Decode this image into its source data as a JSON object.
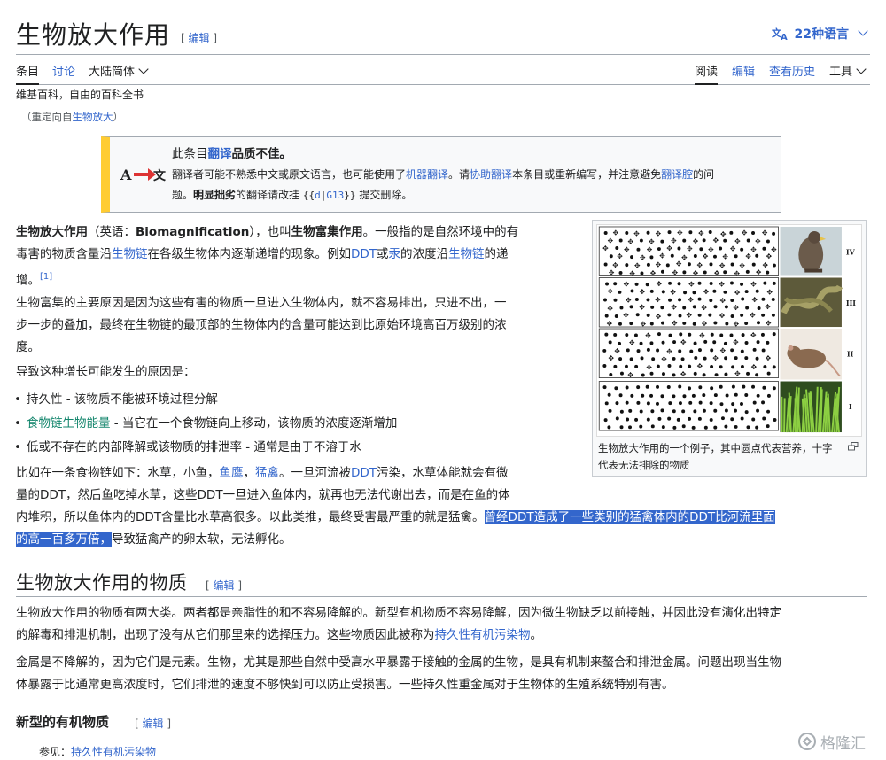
{
  "header": {
    "title": "生物放大作用",
    "edit_label": "编辑",
    "languages_label": "22种语言",
    "languages_icon": "translate-icon"
  },
  "tabs": {
    "article": "条目",
    "talk": "讨论",
    "variant": "大陆简体",
    "read": "阅读",
    "edit": "编辑",
    "history": "查看历史",
    "tools": "工具"
  },
  "tagline": "维基百科，自由的百科全书",
  "redirect": {
    "open": "（重定向自",
    "link": "生物放大",
    "close": "）"
  },
  "ambox": {
    "icon": "translation-arrow-icon",
    "icon_a": "A",
    "icon_b": "文",
    "l1_a": "此条目",
    "l1_b": "翻译",
    "l1_c": "品质不佳。",
    "l2_a": "翻译者可能不熟悉中文或原文语言，也可能使用了",
    "l2_b": "机器翻译",
    "l2_c": "。请",
    "l2_d": "协助翻译",
    "l2_e": "本条目或重新编写，并注意避免",
    "l2_f": "翻译腔",
    "l2_g": "的问",
    "l3_a": "题。",
    "l3_b": "明显拙劣",
    "l3_c": "的翻译请改挂",
    "l3_code_a": "{{",
    "l3_code_b": "d",
    "l3_code_c": "|",
    "l3_code_d": "G13",
    "l3_code_e": "}}",
    "l3_d": "提交删除。"
  },
  "intro": {
    "a": "生物放大作用",
    "b": "（英语：",
    "c": "Biomagnification",
    "d": "），也叫",
    "e": "生物富集作用",
    "f": "。一般指的是自然环境中的有",
    "g": "毒害的物质含量沿",
    "h": "生物链",
    "i": "在各级生物体内逐渐递增的现象。例如",
    "j": "DDT",
    "k": "或",
    "l": "汞",
    "m": "的浓度沿",
    "n": "生物链",
    "o": "的递",
    "p": "增。",
    "ref": "[1]"
  },
  "p2": {
    "l1": "生物富集的主要原因是因为这些有害的物质一旦进入生物体内，就不容易排出，只进不出，一",
    "l2": "步一步的叠加，最终在生物链的最顶部的生物体内的含量可能达到比原始环境高百万级别的浓",
    "l3": "度。"
  },
  "p3": "导致这种增长可能发生的原因是：",
  "bullets": {
    "b1": "持久性 - 该物质不能被环境过程分解",
    "b2_link": "食物链生物能量",
    "b2_rest": " - 当它在一个食物链向上移动，该物质的浓度逐渐增加",
    "b3": "低或不存在的内部降解或该物质的排泄率 - 通常是由于不溶于水"
  },
  "p4": {
    "a": "比如在一条食物链如下：水草，小鱼，",
    "b": "鱼鹰",
    "c": "，",
    "d": "猛禽",
    "e": "。一旦河流被",
    "f": "DDT",
    "g": "污染，水草体能就会有微",
    "l2": "量的DDT，然后鱼吃掉水草，这些DDT一旦进入鱼体内，就再也无法代谢出去，而是在鱼的体",
    "l3a": "内堆积，所以鱼体内的DDT含量比水草高很多。以此类推，最终受害最严重的就是猛禽。",
    "hl1": "曾经DDT造成了一些类别的猛禽体内的DDT比河流里面",
    "hl2": "的高一百多万倍，",
    "tail": "导致猛禽产的卵太软，无法孵化。"
  },
  "thumb": {
    "levels": [
      "IV",
      "III",
      "II",
      "I"
    ],
    "caption": "生物放大作用的一个例子，其中圆点代表营养，十字代表无法排除的物质",
    "enlarge_icon": "enlarge-icon"
  },
  "section1": {
    "title": "生物放大作用的物质",
    "edit": "编辑",
    "p1a": "生物放大作用的物质有两大类。两者都是亲脂性的和不容易降解的。新型有机物质不容易降解，因为微生物缺乏以前接触，并因此没有演化出特定",
    "p1b": "的解毒和排泄机制，出现了没有从它们那里来的选择压力。这些物质因此被称为",
    "p1_link": "持久性有机污染物",
    "p1c": "。",
    "p2a": "金属是不降解的，因为它们是元素。生物，尤其是那些自然中受高水平暴露于接触的金属的生物，是具有机制来螯合和排泄金属。问题出现当生物",
    "p2b": "体暴露于比通常更高浓度时，它们排泄的速度不够快到可以防止受损害。一些持久性重金属对于生物体的生殖系统特别有害。"
  },
  "section2": {
    "title": "新型的有机物质",
    "edit": "编辑",
    "see_also": "参见：",
    "see_link": "持久性有机污染物"
  },
  "watermark": {
    "text": "格隆汇",
    "icon": "gelonghui-logo-icon"
  }
}
